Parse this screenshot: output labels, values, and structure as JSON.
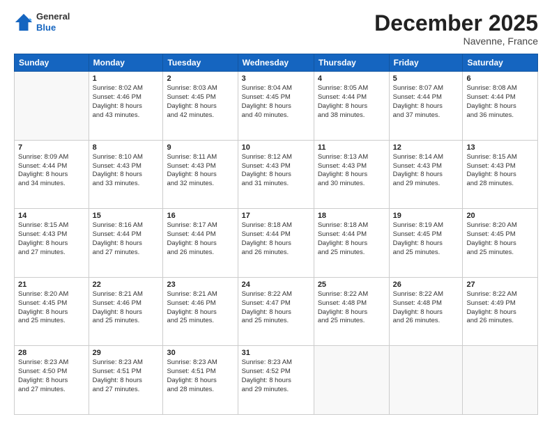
{
  "header": {
    "logo": {
      "general": "General",
      "blue": "Blue"
    },
    "title": "December 2025",
    "location": "Navenne, France"
  },
  "days_of_week": [
    "Sunday",
    "Monday",
    "Tuesday",
    "Wednesday",
    "Thursday",
    "Friday",
    "Saturday"
  ],
  "weeks": [
    [
      {
        "day": "",
        "detail": ""
      },
      {
        "day": "1",
        "detail": "Sunrise: 8:02 AM\nSunset: 4:46 PM\nDaylight: 8 hours\nand 43 minutes."
      },
      {
        "day": "2",
        "detail": "Sunrise: 8:03 AM\nSunset: 4:45 PM\nDaylight: 8 hours\nand 42 minutes."
      },
      {
        "day": "3",
        "detail": "Sunrise: 8:04 AM\nSunset: 4:45 PM\nDaylight: 8 hours\nand 40 minutes."
      },
      {
        "day": "4",
        "detail": "Sunrise: 8:05 AM\nSunset: 4:44 PM\nDaylight: 8 hours\nand 38 minutes."
      },
      {
        "day": "5",
        "detail": "Sunrise: 8:07 AM\nSunset: 4:44 PM\nDaylight: 8 hours\nand 37 minutes."
      },
      {
        "day": "6",
        "detail": "Sunrise: 8:08 AM\nSunset: 4:44 PM\nDaylight: 8 hours\nand 36 minutes."
      }
    ],
    [
      {
        "day": "7",
        "detail": "Sunrise: 8:09 AM\nSunset: 4:44 PM\nDaylight: 8 hours\nand 34 minutes."
      },
      {
        "day": "8",
        "detail": "Sunrise: 8:10 AM\nSunset: 4:43 PM\nDaylight: 8 hours\nand 33 minutes."
      },
      {
        "day": "9",
        "detail": "Sunrise: 8:11 AM\nSunset: 4:43 PM\nDaylight: 8 hours\nand 32 minutes."
      },
      {
        "day": "10",
        "detail": "Sunrise: 8:12 AM\nSunset: 4:43 PM\nDaylight: 8 hours\nand 31 minutes."
      },
      {
        "day": "11",
        "detail": "Sunrise: 8:13 AM\nSunset: 4:43 PM\nDaylight: 8 hours\nand 30 minutes."
      },
      {
        "day": "12",
        "detail": "Sunrise: 8:14 AM\nSunset: 4:43 PM\nDaylight: 8 hours\nand 29 minutes."
      },
      {
        "day": "13",
        "detail": "Sunrise: 8:15 AM\nSunset: 4:43 PM\nDaylight: 8 hours\nand 28 minutes."
      }
    ],
    [
      {
        "day": "14",
        "detail": "Sunrise: 8:15 AM\nSunset: 4:43 PM\nDaylight: 8 hours\nand 27 minutes."
      },
      {
        "day": "15",
        "detail": "Sunrise: 8:16 AM\nSunset: 4:44 PM\nDaylight: 8 hours\nand 27 minutes."
      },
      {
        "day": "16",
        "detail": "Sunrise: 8:17 AM\nSunset: 4:44 PM\nDaylight: 8 hours\nand 26 minutes."
      },
      {
        "day": "17",
        "detail": "Sunrise: 8:18 AM\nSunset: 4:44 PM\nDaylight: 8 hours\nand 26 minutes."
      },
      {
        "day": "18",
        "detail": "Sunrise: 8:18 AM\nSunset: 4:44 PM\nDaylight: 8 hours\nand 25 minutes."
      },
      {
        "day": "19",
        "detail": "Sunrise: 8:19 AM\nSunset: 4:45 PM\nDaylight: 8 hours\nand 25 minutes."
      },
      {
        "day": "20",
        "detail": "Sunrise: 8:20 AM\nSunset: 4:45 PM\nDaylight: 8 hours\nand 25 minutes."
      }
    ],
    [
      {
        "day": "21",
        "detail": "Sunrise: 8:20 AM\nSunset: 4:45 PM\nDaylight: 8 hours\nand 25 minutes."
      },
      {
        "day": "22",
        "detail": "Sunrise: 8:21 AM\nSunset: 4:46 PM\nDaylight: 8 hours\nand 25 minutes."
      },
      {
        "day": "23",
        "detail": "Sunrise: 8:21 AM\nSunset: 4:46 PM\nDaylight: 8 hours\nand 25 minutes."
      },
      {
        "day": "24",
        "detail": "Sunrise: 8:22 AM\nSunset: 4:47 PM\nDaylight: 8 hours\nand 25 minutes."
      },
      {
        "day": "25",
        "detail": "Sunrise: 8:22 AM\nSunset: 4:48 PM\nDaylight: 8 hours\nand 25 minutes."
      },
      {
        "day": "26",
        "detail": "Sunrise: 8:22 AM\nSunset: 4:48 PM\nDaylight: 8 hours\nand 26 minutes."
      },
      {
        "day": "27",
        "detail": "Sunrise: 8:22 AM\nSunset: 4:49 PM\nDaylight: 8 hours\nand 26 minutes."
      }
    ],
    [
      {
        "day": "28",
        "detail": "Sunrise: 8:23 AM\nSunset: 4:50 PM\nDaylight: 8 hours\nand 27 minutes."
      },
      {
        "day": "29",
        "detail": "Sunrise: 8:23 AM\nSunset: 4:51 PM\nDaylight: 8 hours\nand 27 minutes."
      },
      {
        "day": "30",
        "detail": "Sunrise: 8:23 AM\nSunset: 4:51 PM\nDaylight: 8 hours\nand 28 minutes."
      },
      {
        "day": "31",
        "detail": "Sunrise: 8:23 AM\nSunset: 4:52 PM\nDaylight: 8 hours\nand 29 minutes."
      },
      {
        "day": "",
        "detail": ""
      },
      {
        "day": "",
        "detail": ""
      },
      {
        "day": "",
        "detail": ""
      }
    ]
  ]
}
